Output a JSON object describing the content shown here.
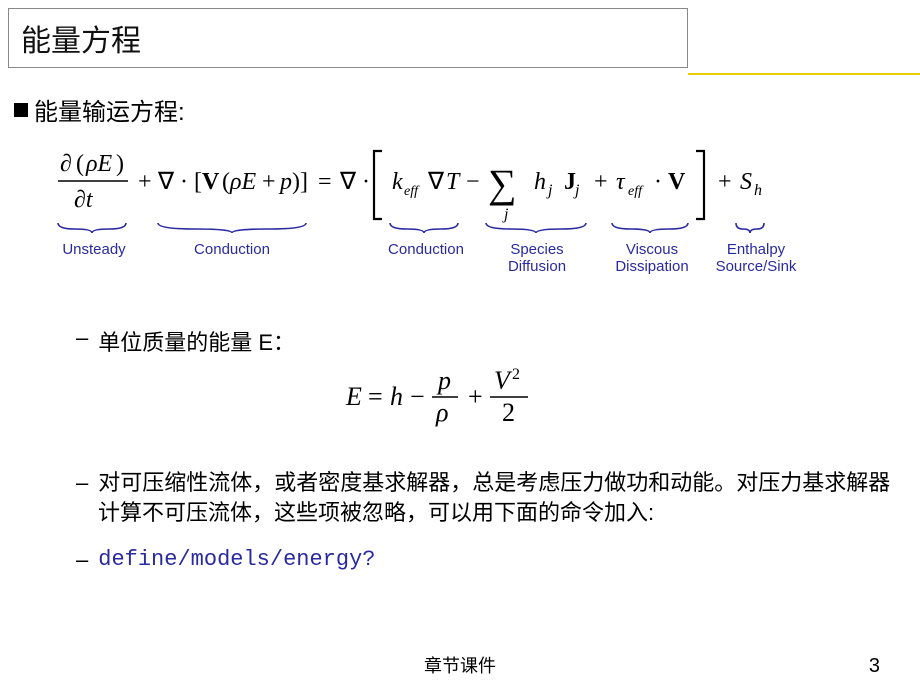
{
  "title": "能量方程",
  "bullet1": "能量输运方程:",
  "annotations": {
    "unsteady": "Unsteady",
    "conduction1": "Conduction",
    "conduction2": "Conduction",
    "species": "Species\nDiffusion",
    "viscous": "Viscous\nDissipation",
    "enthalpy": "Enthalpy\nSource/Sink"
  },
  "sub1": "单位质量的能量 E：",
  "sub2": "对可压缩性流体，或者密度基求解器，总是考虑压力做功和动能。对压力基求解器计算不可压流体，这些项被忽略，可以用下面的命令加入:",
  "command": "define/models/energy?",
  "footer": "章节课件",
  "page": "3",
  "equation1": {
    "description": "∂(ρE)/∂t + ∇·[V(ρE + p)] = ∇·[ k_eff ∇T − Σ_j h_j J_j + τ_eff · V ] + S_h",
    "terms": [
      "∂(ρE)/∂t",
      "∇·[V(ρE+p)]",
      "k_eff∇T",
      "Σ_j h_j J_j",
      "τ_eff·V",
      "S_h"
    ]
  },
  "equation2": {
    "description": "E = h − p/ρ + V²/2"
  }
}
